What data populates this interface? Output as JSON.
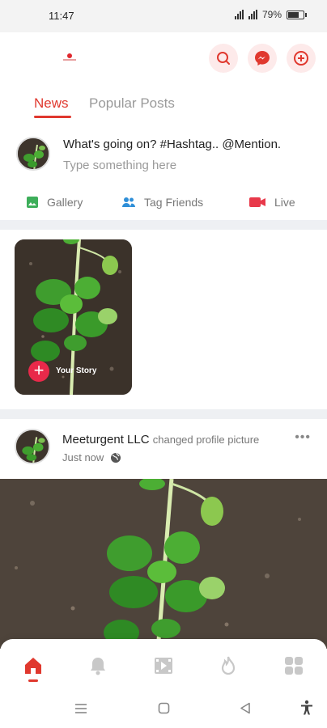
{
  "status_bar": {
    "time": "11:47",
    "battery": "79%",
    "battery_level": 0.79
  },
  "header": {
    "logo": "app-logo",
    "actions": [
      {
        "icon": "search-icon"
      },
      {
        "icon": "messenger-icon"
      },
      {
        "icon": "add-circle-icon"
      }
    ],
    "accent_color": "#e0382e"
  },
  "tabs": {
    "items": [
      "News",
      "Popular Posts"
    ],
    "active": "News"
  },
  "composer": {
    "prompt": "What's going on? #Hashtag.. @Mention.",
    "placeholder": "Type something here",
    "actions": [
      {
        "label": "Gallery",
        "icon": "gallery-icon",
        "color": "#3dae5a"
      },
      {
        "label": "Tag Friends",
        "icon": "people-icon",
        "color": "#2f8fd8"
      },
      {
        "label": "Live",
        "icon": "video-camera-icon",
        "color": "#e8394a"
      }
    ]
  },
  "stories": {
    "your_story_label": "Your Story"
  },
  "post": {
    "author": "Meeturgent LLC",
    "action": "changed profile picture",
    "time": "Just now",
    "privacy_icon": "globe-icon",
    "more_icon": "more-horizontal-icon"
  },
  "bottom_nav": {
    "items": [
      {
        "icon": "home-icon",
        "active": true
      },
      {
        "icon": "bell-icon",
        "active": false
      },
      {
        "icon": "video-play-icon",
        "active": false
      },
      {
        "icon": "fire-icon",
        "active": false
      },
      {
        "icon": "grid-icon",
        "active": false
      }
    ]
  },
  "system_nav": {
    "items": [
      {
        "icon": "menu-icon"
      },
      {
        "icon": "home-square-icon"
      },
      {
        "icon": "back-icon"
      },
      {
        "icon": "accessibility-icon"
      }
    ]
  }
}
